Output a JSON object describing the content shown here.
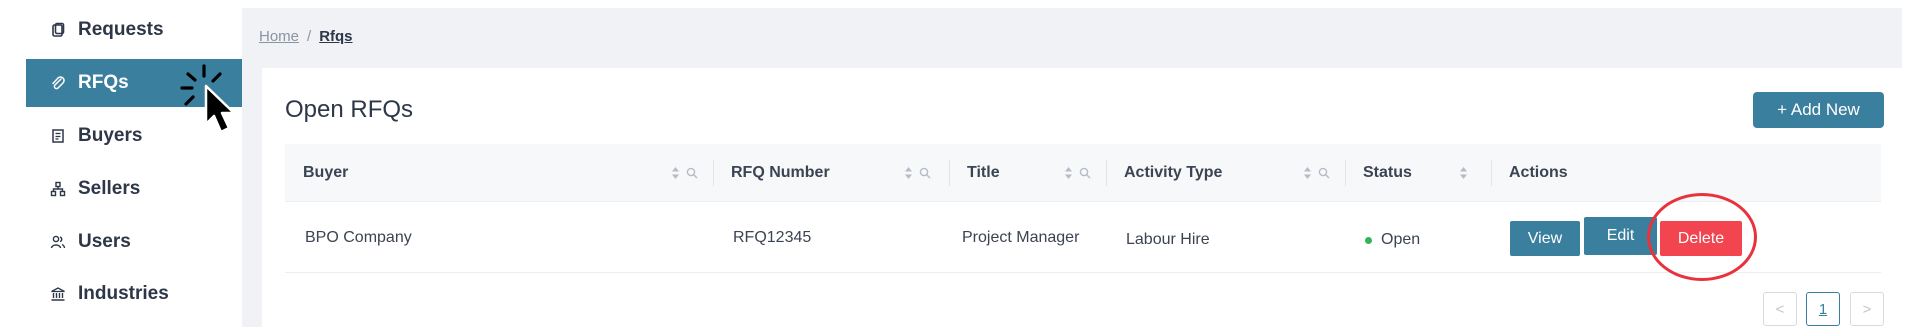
{
  "sidebar": {
    "items": [
      {
        "label": "Requests",
        "icon": "clipboard-icon",
        "active": false
      },
      {
        "label": "RFQs",
        "icon": "paperclip-icon",
        "active": true
      },
      {
        "label": "Buyers",
        "icon": "receipt-icon",
        "active": false
      },
      {
        "label": "Sellers",
        "icon": "hierarchy-icon",
        "active": false
      },
      {
        "label": "Users",
        "icon": "users-icon",
        "active": false
      },
      {
        "label": "Industries",
        "icon": "bank-icon",
        "active": false
      }
    ]
  },
  "breadcrumb": {
    "home": "Home",
    "separator": "/",
    "current": "Rfqs"
  },
  "main": {
    "title": "Open RFQs",
    "add_button": "+ Add New"
  },
  "table": {
    "columns": [
      "Buyer",
      "RFQ Number",
      "Title",
      "Activity Type",
      "Status",
      "Actions"
    ],
    "rows": [
      {
        "buyer": "BPO Company",
        "rfq_number": "RFQ12345",
        "title": "Project Manager",
        "activity_type": "Labour Hire",
        "status": "Open"
      }
    ],
    "actions": {
      "view": "View",
      "edit": "Edit",
      "delete": "Delete"
    }
  },
  "pagination": {
    "prev": "<",
    "current": "1",
    "next": ">"
  },
  "colors": {
    "accent": "#3a7f9e",
    "danger": "#f2454f",
    "status_open": "#34b35a",
    "highlight_circle": "#e8333d"
  }
}
